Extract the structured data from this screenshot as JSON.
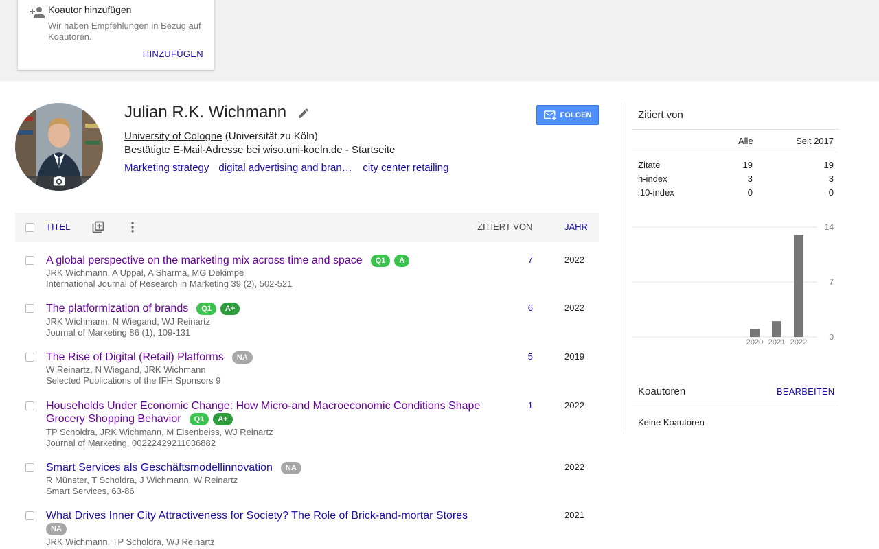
{
  "coauthor_card": {
    "title": "Koautor hinzufügen",
    "description": "Wir haben Empfehlungen in Bezug auf Koautoren.",
    "add_label": "HINZUFÜGEN"
  },
  "profile": {
    "name": "Julian R.K. Wichmann",
    "affiliation_link": "University of Cologne",
    "affiliation_rest": " (Universität zu Köln)",
    "email_text": "Bestätigte E-Mail-Adresse bei wiso.uni-koeln.de - ",
    "homepage_label": "Startseite",
    "interests": [
      "Marketing strategy",
      "digital advertising and brand building",
      "city center retailing"
    ],
    "follow_label": "FOLGEN"
  },
  "table": {
    "title_header": "TITEL",
    "cited_header": "ZITIERT VON",
    "year_header": "JAHR"
  },
  "publications": [
    {
      "title": "A global perspective on the marketing mix across time and space",
      "badges": [
        "Q1",
        "A"
      ],
      "authors": "JRK Wichmann, A Uppal, A Sharma, MG Dekimpe",
      "venue": "International Journal of Research in Marketing 39 (2), 502-521",
      "cited": "7",
      "year": "2022"
    },
    {
      "title": "The platformization of brands",
      "badges": [
        "Q1",
        "A+"
      ],
      "authors": "JRK Wichmann, N Wiegand, WJ Reinartz",
      "venue": "Journal of Marketing 86 (1), 109-131",
      "cited": "6",
      "year": "2022"
    },
    {
      "title": "The Rise of Digital (Retail) Platforms",
      "badges": [
        "NA"
      ],
      "authors": "W Reinartz, N Wiegand, JRK Wichmann",
      "venue": "Selected Publications of the IFH Sponsors 9",
      "cited": "5",
      "year": "2019"
    },
    {
      "title": "Households Under Economic Change: How Micro-and Macroeconomic Conditions Shape Grocery Shopping Behavior",
      "badges": [
        "Q1",
        "A+"
      ],
      "authors": "TP Scholdra, JRK Wichmann, M Eisenbeiss, WJ Reinartz",
      "venue": "Journal of Marketing, 00222429211036882",
      "cited": "1",
      "year": "2022"
    },
    {
      "title": "Smart Services als Geschäftsmodellinnovation",
      "badges": [
        "NA"
      ],
      "authors": "R Münster, T Scholdra, J Wichmann, W Reinartz",
      "venue": "Smart Services, 63-86",
      "cited": "",
      "year": "2022"
    },
    {
      "title": "What Drives Inner City Attractiveness for Society? The Role of Brick-and-mortar Stores",
      "badges": [
        "NA"
      ],
      "authors": "JRK Wichmann, TP Scholdra, WJ Reinartz",
      "venue": "",
      "cited": "",
      "year": "2021"
    }
  ],
  "cited_by": {
    "title": "Zitiert von",
    "col_all": "Alle",
    "col_since": "Seit 2017",
    "rows": [
      {
        "label": "Zitate",
        "all": "19",
        "since": "19"
      },
      {
        "label": "h-index",
        "all": "3",
        "since": "3"
      },
      {
        "label": "i10-index",
        "all": "0",
        "since": "0"
      }
    ]
  },
  "chart_data": {
    "type": "bar",
    "categories": [
      "2020",
      "2021",
      "2022"
    ],
    "values": [
      1,
      2,
      13
    ],
    "ylim": [
      0,
      14
    ],
    "yticks": [
      0,
      7,
      14
    ],
    "bar_color": "#777777"
  },
  "coauthors": {
    "title": "Koautoren",
    "edit_label": "BEARBEITEN",
    "empty_text": "Keine Koautoren"
  },
  "colors": {
    "link": "#1a0dab",
    "visited": "#660099",
    "follow_button": "#4d90fe",
    "badge_green": "#3cc24f",
    "badge_dark_green": "#2e9c3d",
    "badge_grey": "#a6a6a6"
  }
}
